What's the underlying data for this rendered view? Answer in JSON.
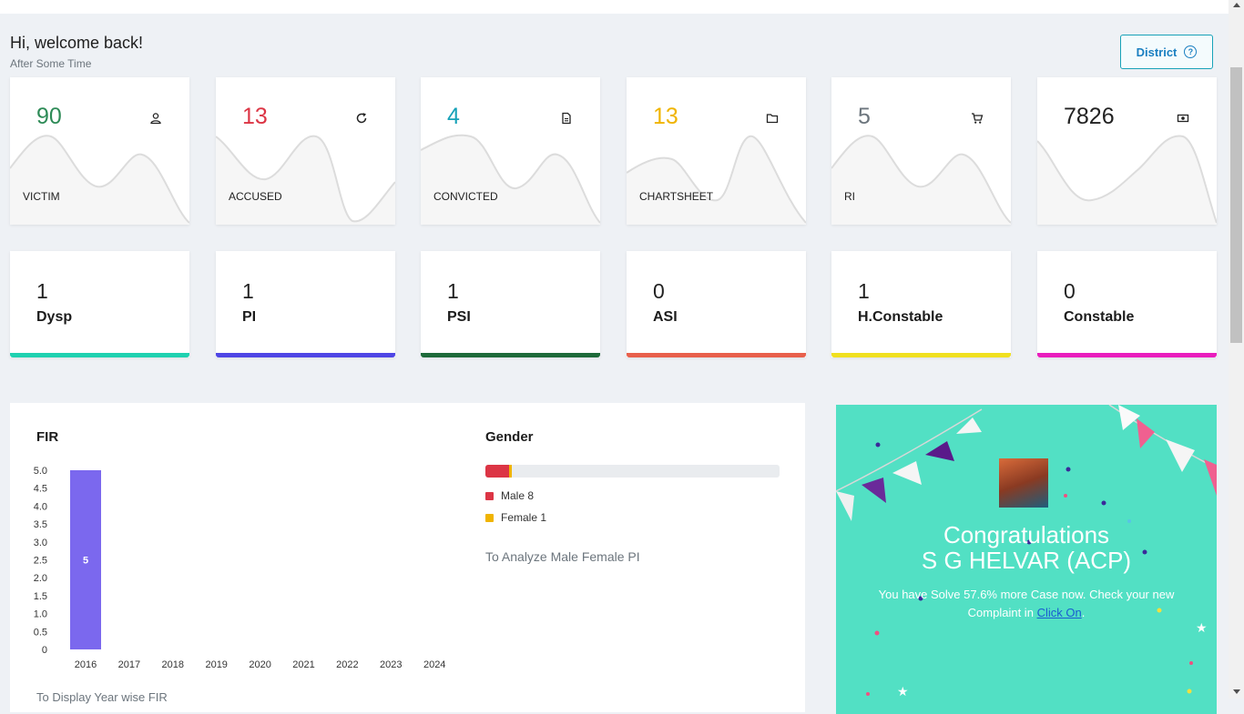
{
  "header": {
    "welcome": "Hi, welcome back!",
    "subtitle": "After Some Time",
    "district_button": "District"
  },
  "stats": [
    {
      "value": "90",
      "label": "VICTIM",
      "color": "#2e8b57",
      "icon": "user-icon"
    },
    {
      "value": "13",
      "label": "ACCUSED",
      "color": "#dc3545",
      "icon": "refresh-icon"
    },
    {
      "value": "4",
      "label": "CONVICTED",
      "color": "#17a2b8",
      "icon": "document-icon"
    },
    {
      "value": "13",
      "label": "CHARTSHEET",
      "color": "#f0b400",
      "icon": "folder-icon"
    },
    {
      "value": "5",
      "label": "RI",
      "color": "#6c757d",
      "icon": "cart-icon"
    },
    {
      "value": "7826",
      "label": "",
      "color": "#222222",
      "icon": "money-icon"
    }
  ],
  "ranks": [
    {
      "value": "1",
      "label": "Dysp",
      "color": "#1fd1b0"
    },
    {
      "value": "1",
      "label": "PI",
      "color": "#4f46e5"
    },
    {
      "value": "1",
      "label": "PSI",
      "color": "#1e6b3a"
    },
    {
      "value": "0",
      "label": "ASI",
      "color": "#e8604c"
    },
    {
      "value": "1",
      "label": "H.Constable",
      "color": "#f0e020"
    },
    {
      "value": "0",
      "label": "Constable",
      "color": "#e91ebd"
    }
  ],
  "fir": {
    "title": "FIR",
    "caption": "To Display Year wise FIR",
    "chart_data": {
      "type": "bar",
      "categories": [
        "2016",
        "2017",
        "2018",
        "2019",
        "2020",
        "2021",
        "2022",
        "2023",
        "2024"
      ],
      "values": [
        5,
        0,
        0,
        0,
        0,
        0,
        0,
        0,
        0
      ],
      "yticks": [
        "0",
        "0.5",
        "1.0",
        "1.5",
        "2.0",
        "2.5",
        "3.0",
        "3.5",
        "4.0",
        "4.5",
        "5.0"
      ],
      "ylim": [
        0,
        5
      ],
      "bar_color": "#7b68ee",
      "data_labels": [
        "5"
      ]
    }
  },
  "gender": {
    "title": "Gender",
    "segments": [
      {
        "label": "Male 8",
        "value": 8,
        "color": "#dc3545"
      },
      {
        "label": "Female 1",
        "value": 1,
        "color": "#f0b400"
      }
    ],
    "total_scale": 100,
    "caption": "To Analyze Male Female PI"
  },
  "congrats": {
    "line1": "Congratulations",
    "line2": "S G HELVAR (ACP)",
    "text": "You have Solve 57.6% more Case now. Check your new Complaint in",
    "link": "Click On",
    "after": "."
  }
}
